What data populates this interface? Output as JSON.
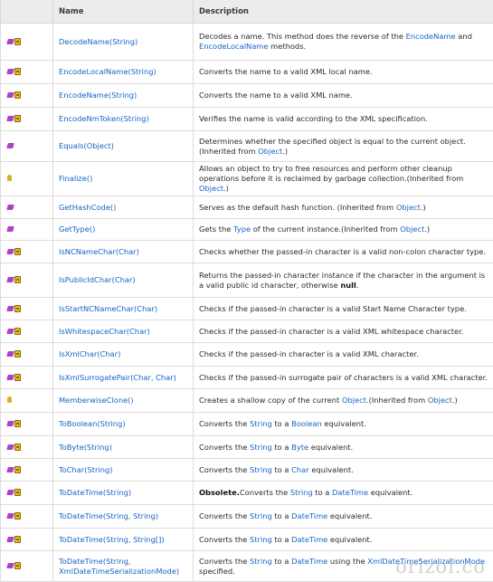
{
  "header": {
    "name_col": "Name",
    "desc_col": "Description"
  },
  "rows": [
    {
      "icons": [
        "method",
        "static"
      ],
      "name": "DecodeName(String)",
      "h": 41,
      "desc": [
        [
          "t",
          "Decodes a name. This method does the reverse of the "
        ],
        [
          "l",
          "EncodeName"
        ],
        [
          "t",
          " and "
        ],
        [
          "l",
          "EncodeLocalName"
        ],
        [
          "t",
          " methods."
        ]
      ]
    },
    {
      "icons": [
        "method",
        "static"
      ],
      "name": "EncodeLocalName(String)",
      "h": 26,
      "desc": [
        [
          "t",
          "Converts the name to a valid XML local name."
        ]
      ]
    },
    {
      "icons": [
        "method",
        "static"
      ],
      "name": "EncodeName(String)",
      "h": 26,
      "desc": [
        [
          "t",
          "Converts the name to a valid XML name."
        ]
      ]
    },
    {
      "icons": [
        "method",
        "static"
      ],
      "name": "EncodeNmToken(String)",
      "h": 26,
      "desc": [
        [
          "t",
          "Verifies the name is valid according to the XML specification."
        ]
      ]
    },
    {
      "icons": [
        "method"
      ],
      "name": "Equals(Object)",
      "h": 34,
      "desc": [
        [
          "t",
          "Determines whether the specified object is equal to the current object.(Inherited from "
        ],
        [
          "l",
          "Object"
        ],
        [
          "t",
          ".)"
        ]
      ]
    },
    {
      "icons": [
        "protected"
      ],
      "name": "Finalize()",
      "h": 38,
      "desc": [
        [
          "t",
          "Allows an object to try to free resources and perform other cleanup operations before it is reclaimed by garbage collection.(Inherited from "
        ],
        [
          "l",
          "Object"
        ],
        [
          "t",
          ".)"
        ]
      ]
    },
    {
      "icons": [
        "method"
      ],
      "name": "GetHashCode()",
      "h": 25,
      "desc": [
        [
          "t",
          "Serves as the default hash function. (Inherited from "
        ],
        [
          "l",
          "Object"
        ],
        [
          "t",
          ".)"
        ]
      ]
    },
    {
      "icons": [
        "method"
      ],
      "name": "GetType()",
      "h": 24,
      "desc": [
        [
          "t",
          "Gets the "
        ],
        [
          "l",
          "Type"
        ],
        [
          "t",
          " of the current instance.(Inherited from "
        ],
        [
          "l",
          "Object"
        ],
        [
          "t",
          ".)"
        ]
      ]
    },
    {
      "icons": [
        "method",
        "static"
      ],
      "name": "IsNCNameChar(Char)",
      "h": 25,
      "desc": [
        [
          "t",
          "Checks whether the passed-in character is a valid non-colon character type."
        ]
      ]
    },
    {
      "icons": [
        "method",
        "static"
      ],
      "name": "IsPublicIdChar(Char)",
      "h": 38,
      "desc": [
        [
          "t",
          "Returns the passed-in character instance if the character in the argument is a valid public id character, otherwise "
        ],
        [
          "b",
          "null"
        ],
        [
          "t",
          "."
        ]
      ]
    },
    {
      "icons": [
        "method",
        "static"
      ],
      "name": "IsStartNCNameChar(Char)",
      "h": 25,
      "desc": [
        [
          "t",
          "Checks if the passed-in character is a valid Start Name Character type."
        ]
      ]
    },
    {
      "icons": [
        "method",
        "static"
      ],
      "name": "IsWhitespaceChar(Char)",
      "h": 25,
      "desc": [
        [
          "t",
          "Checks if the passed-in character is a valid XML whitespace character."
        ]
      ]
    },
    {
      "icons": [
        "method",
        "static"
      ],
      "name": "IsXmlChar(Char)",
      "h": 26,
      "desc": [
        [
          "t",
          "Checks if the passed-in character is a valid XML character."
        ]
      ]
    },
    {
      "icons": [
        "method",
        "static"
      ],
      "name": "IsXmlSurrogatePair(Char,  Char)",
      "h": 25,
      "desc": [
        [
          "t",
          "Checks if the passed-in surrogate pair of characters is a valid XML character."
        ]
      ]
    },
    {
      "icons": [
        "protected"
      ],
      "name": "MemberwiseClone()",
      "h": 26,
      "desc": [
        [
          "t",
          "Creates a shallow copy of the current "
        ],
        [
          "l",
          "Object"
        ],
        [
          "t",
          ".(Inherited from "
        ],
        [
          "l",
          "Object"
        ],
        [
          "t",
          ".)"
        ]
      ]
    },
    {
      "icons": [
        "method",
        "static"
      ],
      "name": "ToBoolean(String)",
      "h": 26,
      "desc": [
        [
          "t",
          "Converts the "
        ],
        [
          "l",
          "String"
        ],
        [
          "t",
          " to a "
        ],
        [
          "l",
          "Boolean"
        ],
        [
          "t",
          " equivalent."
        ]
      ]
    },
    {
      "icons": [
        "method",
        "static"
      ],
      "name": "ToByte(String)",
      "h": 25,
      "desc": [
        [
          "t",
          "Converts the "
        ],
        [
          "l",
          "String"
        ],
        [
          "t",
          " to a "
        ],
        [
          "l",
          "Byte"
        ],
        [
          "t",
          " equivalent."
        ]
      ]
    },
    {
      "icons": [
        "method",
        "static"
      ],
      "name": "ToChar(String)",
      "h": 25,
      "desc": [
        [
          "t",
          "Converts the "
        ],
        [
          "l",
          "String"
        ],
        [
          "t",
          " to a "
        ],
        [
          "l",
          "Char"
        ],
        [
          "t",
          " equivalent."
        ]
      ]
    },
    {
      "icons": [
        "method",
        "static"
      ],
      "name": "ToDateTime(String)",
      "h": 26,
      "desc": [
        [
          "b",
          "Obsolete."
        ],
        [
          "t",
          "Converts the "
        ],
        [
          "l",
          "String"
        ],
        [
          "t",
          " to a "
        ],
        [
          "l",
          "DateTime"
        ],
        [
          "t",
          " equivalent."
        ]
      ]
    },
    {
      "icons": [
        "method",
        "static"
      ],
      "name": "ToDateTime(String,  String)",
      "h": 26,
      "desc": [
        [
          "t",
          "Converts the "
        ],
        [
          "l",
          "String"
        ],
        [
          "t",
          " to a "
        ],
        [
          "l",
          "DateTime"
        ],
        [
          "t",
          " equivalent."
        ]
      ]
    },
    {
      "icons": [
        "method",
        "static"
      ],
      "name": "ToDateTime(String,  String[])",
      "h": 25,
      "desc": [
        [
          "t",
          "Converts the "
        ],
        [
          "l",
          "String"
        ],
        [
          "t",
          " to a "
        ],
        [
          "l",
          "DateTime"
        ],
        [
          "t",
          " equivalent."
        ]
      ]
    },
    {
      "icons": [
        "method",
        "static"
      ],
      "name": "ToDateTime(String, XmlDateTimeSerializationMode)",
      "h": 34,
      "desc": [
        [
          "t",
          "Converts the "
        ],
        [
          "l",
          "String"
        ],
        [
          "t",
          " to a "
        ],
        [
          "l",
          "DateTime"
        ],
        [
          "t",
          " using the "
        ],
        [
          "l",
          "XmlDateTimeSerializationMode"
        ],
        [
          "t",
          " specified."
        ]
      ]
    }
  ],
  "watermark": "orizol.co"
}
